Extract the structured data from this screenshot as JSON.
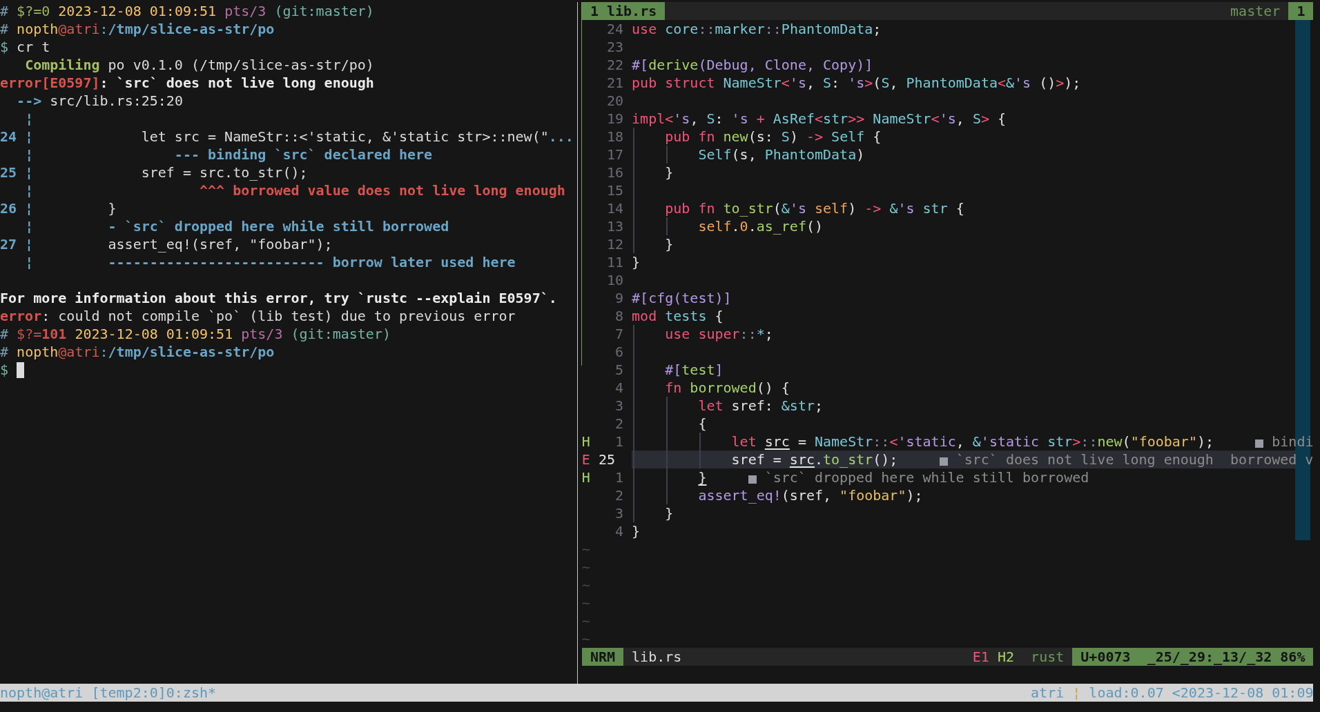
{
  "left_pane": {
    "lines": [
      {
        "kind": "text",
        "segments": [
          {
            "text": "# ",
            "kind": "prompt"
          },
          {
            "text": "$?=0 ",
            "kind": "ok"
          },
          {
            "text": "2023-12-08 01:09:51 ",
            "kind": "date"
          },
          {
            "text": "pts/3 ",
            "kind": "tty"
          },
          {
            "text": "(git:master)",
            "kind": "git"
          }
        ]
      },
      {
        "kind": "text",
        "segments": [
          {
            "text": "# ",
            "kind": "prompt"
          },
          {
            "text": "nopth",
            "kind": "user"
          },
          {
            "text": "@atri",
            "kind": "host"
          },
          {
            "text": ":",
            "kind": "sep"
          },
          {
            "text": "/tmp/slice-as-str/po",
            "kind": "path"
          }
        ]
      },
      {
        "kind": "text",
        "segments": [
          {
            "text": "$ ",
            "kind": "dollar"
          },
          {
            "text": "cr t",
            "kind": "plain"
          }
        ]
      },
      {
        "kind": "text",
        "segments": [
          {
            "text": "   Compiling",
            "kind": "status"
          },
          {
            "text": " po v0.1.0 (/tmp/slice-as-str/po)",
            "kind": "plain"
          }
        ]
      },
      {
        "kind": "text",
        "segments": [
          {
            "text": "error[E0597]",
            "kind": "error"
          },
          {
            "text": ": `src` does not live long enough",
            "kind": "strong"
          }
        ]
      },
      {
        "kind": "text",
        "segments": [
          {
            "text": "  -->",
            "kind": "note"
          },
          {
            "text": " src/lib.rs:25:20",
            "kind": "plain"
          }
        ]
      },
      {
        "kind": "text",
        "segments": [
          {
            "text": "   ¦",
            "kind": "note"
          }
        ]
      },
      {
        "kind": "text",
        "segments": [
          {
            "text": "24 ¦",
            "kind": "note"
          },
          {
            "text": "             let src = NameStr::<'static, &'static str>::new(\"",
            "kind": "plain"
          },
          {
            "text": "...",
            "kind": "note"
          }
        ]
      },
      {
        "kind": "text",
        "segments": [
          {
            "text": "   ¦                 --- binding `src` declared here",
            "kind": "note"
          }
        ]
      },
      {
        "kind": "text",
        "segments": [
          {
            "text": "25 ¦",
            "kind": "note"
          },
          {
            "text": "             sref = src.to_str();",
            "kind": "plain"
          }
        ]
      },
      {
        "kind": "text",
        "segments": [
          {
            "text": "   ¦",
            "kind": "note"
          },
          {
            "text": "                    ^^^ borrowed value does not live long enough",
            "kind": "label"
          }
        ]
      },
      {
        "kind": "text",
        "segments": [
          {
            "text": "26 ¦",
            "kind": "note"
          },
          {
            "text": "         }",
            "kind": "plain"
          }
        ]
      },
      {
        "kind": "text",
        "segments": [
          {
            "text": "   ¦         - `src` dropped here while still borrowed",
            "kind": "note"
          }
        ]
      },
      {
        "kind": "text",
        "segments": [
          {
            "text": "27 ¦",
            "kind": "note"
          },
          {
            "text": "         assert_eq!(sref, \"foobar\");",
            "kind": "plain"
          }
        ]
      },
      {
        "kind": "text",
        "segments": [
          {
            "text": "   ¦         -------------------------- borrow later used here",
            "kind": "note"
          }
        ]
      },
      {
        "kind": "blank"
      },
      {
        "kind": "text",
        "segments": [
          {
            "text": "For more information about this error, try `rustc --explain E0597`.",
            "kind": "strong"
          }
        ]
      },
      {
        "kind": "text",
        "segments": [
          {
            "text": "error",
            "kind": "error"
          },
          {
            "text": ": could not compile `po` (lib test) due to previous error",
            "kind": "plain"
          }
        ]
      },
      {
        "kind": "text",
        "segments": [
          {
            "text": "# ",
            "kind": "prompt"
          },
          {
            "text": "$?=",
            "kind": "fail"
          },
          {
            "text": "101 ",
            "kind": "failcode"
          },
          {
            "text": "2023-12-08 01:09:51 ",
            "kind": "date"
          },
          {
            "text": "pts/3 ",
            "kind": "tty"
          },
          {
            "text": "(git:master)",
            "kind": "git"
          }
        ]
      },
      {
        "kind": "text",
        "segments": [
          {
            "text": "# ",
            "kind": "prompt"
          },
          {
            "text": "nopth",
            "kind": "user"
          },
          {
            "text": "@atri",
            "kind": "host"
          },
          {
            "text": ":",
            "kind": "sep"
          },
          {
            "text": "/tmp/slice-as-str/po",
            "kind": "path"
          }
        ]
      },
      {
        "kind": "text",
        "segments": [
          {
            "text": "$ ",
            "kind": "dollar"
          }
        ]
      }
    ],
    "cursor": {
      "kind": "block"
    }
  },
  "right_pane": {
    "tab_bar": {
      "tabs": [
        {
          "label": "1 lib.rs",
          "selected": true
        }
      ],
      "branch": "master",
      "window_number": "1"
    },
    "lines": [
      {
        "number": "24",
        "current": false,
        "segments": [
          {
            "text": "use ",
            "kind": "kw"
          },
          {
            "text": "core",
            "kind": "ty"
          },
          {
            "text": "::",
            "kind": "op"
          },
          {
            "text": "marker",
            "kind": "ty"
          },
          {
            "text": "::",
            "kind": "op"
          },
          {
            "text": "PhantomData",
            "kind": "ty"
          },
          {
            "text": ";",
            "kind": "plain"
          }
        ]
      },
      {
        "number": "23",
        "current": false
      },
      {
        "number": "22",
        "current": false,
        "segments": [
          {
            "text": "#[",
            "kind": "attr"
          },
          {
            "text": "derive",
            "kind": "fn"
          },
          {
            "text": "(Debug, Clone, Copy)]",
            "kind": "attr"
          }
        ]
      },
      {
        "number": "21",
        "current": false,
        "segments": [
          {
            "text": "pub struct ",
            "kind": "kw"
          },
          {
            "text": "NameStr",
            "kind": "ty"
          },
          {
            "text": "<",
            "kind": "kw"
          },
          {
            "text": "'s",
            "kind": "lt"
          },
          {
            "text": ", ",
            "kind": "plain"
          },
          {
            "text": "S",
            "kind": "ty"
          },
          {
            "text": ": ",
            "kind": "plain"
          },
          {
            "text": "'s",
            "kind": "lt"
          },
          {
            "text": ">",
            "kind": "kw"
          },
          {
            "text": "(",
            "kind": "plain"
          },
          {
            "text": "S",
            "kind": "ty"
          },
          {
            "text": ", ",
            "kind": "plain"
          },
          {
            "text": "PhantomData",
            "kind": "ty"
          },
          {
            "text": "<",
            "kind": "kw"
          },
          {
            "text": "&",
            "kind": "ty"
          },
          {
            "text": "'s",
            "kind": "lt"
          },
          {
            "text": " ()",
            "kind": "plain"
          },
          {
            "text": ">",
            "kind": "kw"
          },
          {
            "text": ");",
            "kind": "plain"
          }
        ]
      },
      {
        "number": "20",
        "current": false
      },
      {
        "number": "19",
        "current": false,
        "segments": [
          {
            "text": "impl<",
            "kind": "kw"
          },
          {
            "text": "'s",
            "kind": "lt"
          },
          {
            "text": ", ",
            "kind": "plain"
          },
          {
            "text": "S",
            "kind": "ty"
          },
          {
            "text": ": ",
            "kind": "plain"
          },
          {
            "text": "'s",
            "kind": "lt"
          },
          {
            "text": " + ",
            "kind": "kw"
          },
          {
            "text": "AsRef",
            "kind": "ty"
          },
          {
            "text": "<",
            "kind": "kw"
          },
          {
            "text": "str",
            "kind": "ty"
          },
          {
            "text": ">> ",
            "kind": "kw"
          },
          {
            "text": "NameStr",
            "kind": "ty"
          },
          {
            "text": "<",
            "kind": "kw"
          },
          {
            "text": "'s",
            "kind": "lt"
          },
          {
            "text": ", ",
            "kind": "plain"
          },
          {
            "text": "S",
            "kind": "ty"
          },
          {
            "text": ">",
            "kind": "kw"
          },
          {
            "text": " {",
            "kind": "plain"
          }
        ]
      },
      {
        "number": "18",
        "current": false,
        "segments": [
          {
            "text": "    pub fn ",
            "kind": "kw"
          },
          {
            "text": "new",
            "kind": "fn"
          },
          {
            "text": "(s: ",
            "kind": "plain"
          },
          {
            "text": "S",
            "kind": "ty"
          },
          {
            "text": ") ",
            "kind": "plain"
          },
          {
            "text": "-> ",
            "kind": "kw"
          },
          {
            "text": "Self",
            "kind": "ty"
          },
          {
            "text": " {",
            "kind": "plain"
          }
        ]
      },
      {
        "number": "17",
        "current": false,
        "segments": [
          {
            "text": "        Self",
            "kind": "ty"
          },
          {
            "text": "(s, ",
            "kind": "plain"
          },
          {
            "text": "PhantomData",
            "kind": "ty"
          },
          {
            "text": ")",
            "kind": "plain"
          }
        ]
      },
      {
        "number": "16",
        "current": false,
        "segments": [
          {
            "text": "    }",
            "kind": "plain"
          }
        ]
      },
      {
        "number": "15",
        "current": false
      },
      {
        "number": "14",
        "current": false,
        "segments": [
          {
            "text": "    pub fn ",
            "kind": "kw"
          },
          {
            "text": "to_str",
            "kind": "fn"
          },
          {
            "text": "(",
            "kind": "plain"
          },
          {
            "text": "&",
            "kind": "ty"
          },
          {
            "text": "'s ",
            "kind": "lt"
          },
          {
            "text": "self",
            "kind": "self"
          },
          {
            "text": ") ",
            "kind": "plain"
          },
          {
            "text": "-> ",
            "kind": "kw"
          },
          {
            "text": "&",
            "kind": "ty"
          },
          {
            "text": "'s ",
            "kind": "lt"
          },
          {
            "text": "str",
            "kind": "ty"
          },
          {
            "text": " {",
            "kind": "plain"
          }
        ]
      },
      {
        "number": "13",
        "current": false,
        "segments": [
          {
            "text": "        self",
            "kind": "self"
          },
          {
            "text": ".",
            "kind": "plain"
          },
          {
            "text": "0",
            "kind": "self"
          },
          {
            "text": ".",
            "kind": "plain"
          },
          {
            "text": "as_ref",
            "kind": "fn"
          },
          {
            "text": "()",
            "kind": "plain"
          }
        ]
      },
      {
        "number": "12",
        "current": false,
        "segments": [
          {
            "text": "    }",
            "kind": "plain"
          }
        ]
      },
      {
        "number": "11",
        "current": false,
        "segments": [
          {
            "text": "}",
            "kind": "plain"
          }
        ]
      },
      {
        "number": "10",
        "current": false
      },
      {
        "number": "9",
        "current": false,
        "segments": [
          {
            "text": "#[cfg(test)]",
            "kind": "attr"
          }
        ]
      },
      {
        "number": "8",
        "current": false,
        "segments": [
          {
            "text": "mod ",
            "kind": "kw"
          },
          {
            "text": "tests",
            "kind": "ty"
          },
          {
            "text": " {",
            "kind": "plain"
          }
        ]
      },
      {
        "number": "7",
        "current": false,
        "segments": [
          {
            "text": "    use super",
            "kind": "kw"
          },
          {
            "text": "::",
            "kind": "op"
          },
          {
            "text": "*",
            "kind": "ty"
          },
          {
            "text": ";",
            "kind": "plain"
          }
        ]
      },
      {
        "number": "6",
        "current": false
      },
      {
        "number": "5",
        "current": false,
        "segments": [
          {
            "text": "    #[",
            "kind": "attr"
          },
          {
            "text": "test",
            "kind": "fn"
          },
          {
            "text": "]",
            "kind": "attr"
          }
        ]
      },
      {
        "number": "4",
        "current": false,
        "segments": [
          {
            "text": "    fn ",
            "kind": "kw"
          },
          {
            "text": "borrowed",
            "kind": "fn"
          },
          {
            "text": "() {",
            "kind": "plain"
          }
        ]
      },
      {
        "number": "3",
        "current": false,
        "segments": [
          {
            "text": "        let ",
            "kind": "kw"
          },
          {
            "text": "sref: ",
            "kind": "plain"
          },
          {
            "text": "&str",
            "kind": "ty"
          },
          {
            "text": ";",
            "kind": "plain"
          }
        ]
      },
      {
        "number": "2",
        "current": false,
        "segments": [
          {
            "text": "        {",
            "kind": "plain"
          }
        ]
      },
      {
        "number": "1",
        "current": false,
        "sign": {
          "text": "H",
          "kind": "hint"
        },
        "segments": [
          {
            "text": "            let ",
            "kind": "kw"
          },
          {
            "text": "src",
            "kind": "under"
          },
          {
            "text": " = ",
            "kind": "plain"
          },
          {
            "text": "NameStr",
            "kind": "ty"
          },
          {
            "text": "::",
            "kind": "op"
          },
          {
            "text": "<",
            "kind": "kw"
          },
          {
            "text": "'static",
            "kind": "lt"
          },
          {
            "text": ", ",
            "kind": "plain"
          },
          {
            "text": "&",
            "kind": "ty"
          },
          {
            "text": "'static ",
            "kind": "lt"
          },
          {
            "text": "str",
            "kind": "ty"
          },
          {
            "text": ">",
            "kind": "kw"
          },
          {
            "text": "::",
            "kind": "op"
          },
          {
            "text": "new",
            "kind": "fn"
          },
          {
            "text": "(",
            "kind": "plain"
          },
          {
            "text": "\"foobar\"",
            "kind": "str"
          },
          {
            "text": ");",
            "kind": "plain"
          }
        ],
        "diagnostics": [
          "bindi"
        ]
      },
      {
        "number": "25",
        "current": true,
        "sign": {
          "text": "E",
          "kind": "error"
        },
        "segments": [
          {
            "text": "            sref = ",
            "kind": "plain"
          },
          {
            "text": "src",
            "kind": "under"
          },
          {
            "text": ".",
            "kind": "plain"
          },
          {
            "text": "to_str",
            "kind": "fn"
          },
          {
            "text": "();",
            "kind": "plain"
          }
        ],
        "diagnostics": [
          "`src` does not live long enough",
          "borrowed v"
        ]
      },
      {
        "number": "1",
        "current": false,
        "sign": {
          "text": "H",
          "kind": "hint"
        },
        "segments": [
          {
            "text": "        }",
            "kind": "under"
          }
        ],
        "diagnostics": [
          "`src` dropped here while still borrowed"
        ]
      },
      {
        "number": "2",
        "current": false,
        "segments": [
          {
            "text": "        assert_eq!",
            "kind": "macro"
          },
          {
            "text": "(sref, ",
            "kind": "plain"
          },
          {
            "text": "\"foobar\"",
            "kind": "str"
          },
          {
            "text": ");",
            "kind": "plain"
          }
        ]
      },
      {
        "number": "3",
        "current": false,
        "segments": [
          {
            "text": "    }",
            "kind": "plain"
          }
        ]
      },
      {
        "number": "4",
        "current": false,
        "segments": [
          {
            "text": "}",
            "kind": "plain"
          }
        ]
      }
    ],
    "filler_lines": [
      "~",
      "~",
      "~",
      "~",
      "~",
      "~"
    ],
    "status_line": {
      "mode": "NRM",
      "file": "lib.rs",
      "errors": "E1",
      "hints": "H2",
      "language": "rust",
      "codepoint": "U+0073",
      "position": "_25/_29:_13/_32",
      "percent": "86%"
    }
  },
  "tmux_status_bar": {
    "session": "nopth@atri",
    "windows": "[temp2:0]0:zsh*",
    "host": "atri",
    "separator": "¦",
    "load": "load:0.07",
    "clock": "<2023-12-08 01:09"
  }
}
